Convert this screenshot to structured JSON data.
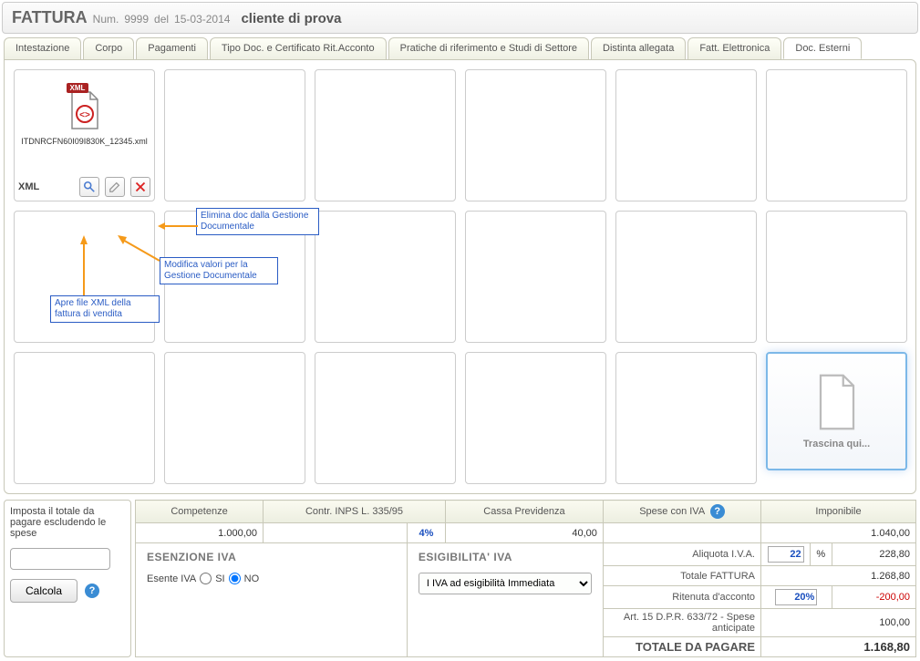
{
  "header": {
    "title": "FATTURA",
    "num_label": "Num.",
    "num": "9999",
    "del_label": "del",
    "date": "15-03-2014",
    "client": "cliente di prova"
  },
  "tabs": [
    {
      "label": "Intestazione"
    },
    {
      "label": "Corpo"
    },
    {
      "label": "Pagamenti"
    },
    {
      "label": "Tipo Doc. e Certificato Rit.Acconto"
    },
    {
      "label": "Pratiche di riferimento e Studi di Settore"
    },
    {
      "label": "Distinta allegata"
    },
    {
      "label": "Fatt. Elettronica"
    },
    {
      "label": "Doc. Esterni",
      "active": true
    }
  ],
  "file": {
    "badge": "XML",
    "name": "ITDNRCFN60I09I830K_12345.xml",
    "type_label": "XML"
  },
  "drop_label": "Trascina qui...",
  "annotations": {
    "open_xml": "Apre file XML della fattura di vendita",
    "edit_doc": "Modifica valori per la Gestione Documentale",
    "delete_doc": "Elimina doc dalla Gestione Documentale"
  },
  "calc": {
    "label": "Imposta il totale da pagare escludendo le spese",
    "button": "Calcola"
  },
  "totals": {
    "headers": {
      "competenze": "Competenze",
      "contr": "Contr. INPS L. 335/95",
      "cassa": "Cassa Previdenza",
      "spese": "Spese con IVA",
      "imponibile": "Imponibile"
    },
    "row1": {
      "competenze": "1.000,00",
      "contr_pct": "4%",
      "cassa": "40,00",
      "imponibile": "1.040,00"
    },
    "esenzione": {
      "title": "ESENZIONE IVA",
      "label": "Esente IVA",
      "si": "SI",
      "no": "NO"
    },
    "esigibilita": {
      "title": "ESIGIBILITA' IVA",
      "selected": "I IVA ad esigibilità Immediata"
    },
    "lines": {
      "aliquota_label": "Aliquota I.V.A.",
      "aliquota_val": "22",
      "aliquota_unit": "%",
      "aliquota_amount": "228,80",
      "totale_fattura_label": "Totale FATTURA",
      "totale_fattura": "1.268,80",
      "ritenuta_label": "Ritenuta d'acconto",
      "ritenuta_pct": "20%",
      "ritenuta_amount": "-200,00",
      "art15_label": "Art. 15 D.P.R. 633/72 - Spese anticipate",
      "art15_amount": "100,00",
      "grand_label": "TOTALE DA PAGARE",
      "grand_amount": "1.168,80"
    }
  }
}
